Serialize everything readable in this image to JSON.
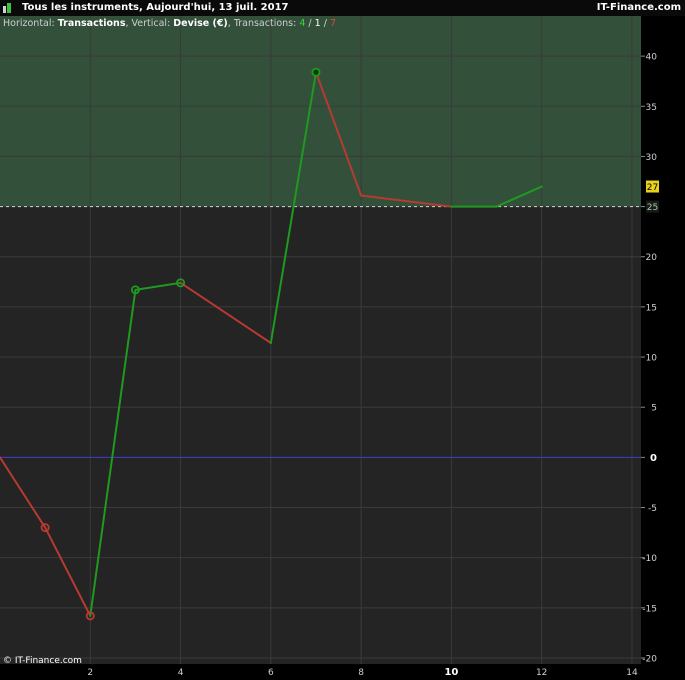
{
  "header": {
    "title": "Tous les instruments, Aujourd'hui, 13 juil. 2017",
    "brand": "IT-Finance.com",
    "logo_icon": "bar-chart-logo-icon"
  },
  "info": {
    "horizontal_label": "Horizontal: ",
    "horizontal_value": "Transactions",
    "vertical_label": ", Vertical: ",
    "vertical_value": "Devise (€)",
    "transactions_label": ", Transactions: ",
    "count_win": "4",
    "sep1": " / ",
    "count_flat": "1",
    "sep2": " / ",
    "count_loss": "7"
  },
  "copyright": "© IT-Finance.com",
  "chart_data": {
    "type": "line",
    "x": [
      0,
      1,
      2,
      3,
      4,
      6,
      7,
      8,
      10,
      11,
      12
    ],
    "y": [
      0,
      -7,
      -15.8,
      16.7,
      17.4,
      11.4,
      38.4,
      26.1,
      25,
      25,
      27
    ],
    "markers": [
      {
        "x": 1,
        "y": -7,
        "style": "loss-hollow"
      },
      {
        "x": 2,
        "y": -15.8,
        "style": "loss-hollow"
      },
      {
        "x": 3,
        "y": 16.7,
        "style": "win-hollow"
      },
      {
        "x": 4,
        "y": 17.4,
        "style": "win-hollow"
      },
      {
        "x": 7,
        "y": 38.4,
        "style": "win-filled"
      }
    ],
    "xlim": [
      0,
      14.2
    ],
    "ylim": [
      -20.6,
      44
    ],
    "xticks": [
      2,
      4,
      6,
      8,
      10,
      12,
      14
    ],
    "xtick_labels": [
      "2",
      "4",
      "6",
      "8",
      "10",
      "12",
      "14"
    ],
    "yticks": [
      40,
      35,
      30,
      25,
      20,
      15,
      10,
      5,
      0,
      -5,
      -10,
      -15,
      -20
    ],
    "ytick_labels": [
      "40",
      "35",
      "30",
      "25",
      "20",
      "15",
      "10",
      "5",
      "0",
      "-5",
      "-10",
      "-15",
      "-20"
    ],
    "zero_line": 0,
    "threshold": 25,
    "threshold_label": "25",
    "current_value": 27,
    "current_label": "27",
    "grid": true,
    "colors": {
      "background": "#242424",
      "profit_zone": "#33503a",
      "grid": "#3a3a3a",
      "up": "#1f9a1f",
      "down": "#b73a32",
      "zero_line": "#3c3cc8",
      "badge": "#e8d21c"
    }
  }
}
